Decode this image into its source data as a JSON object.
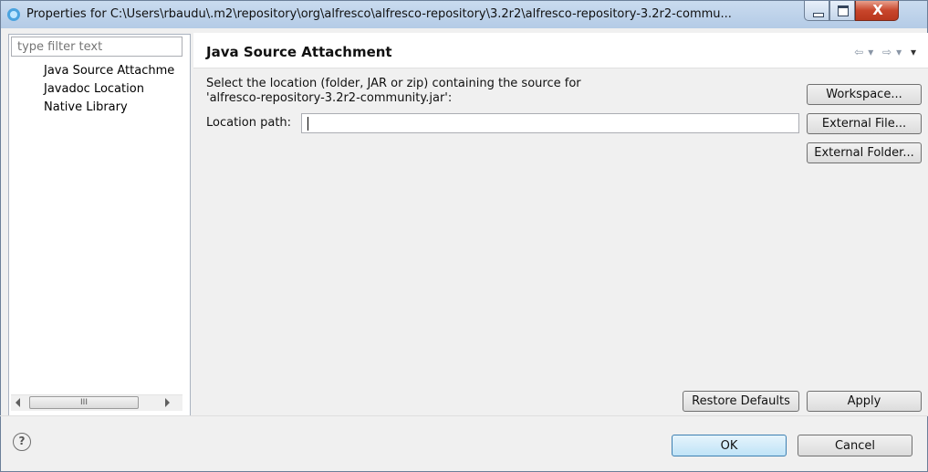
{
  "window": {
    "title": "Properties for C:\\Users\\rbaudu\\.m2\\repository\\org\\alfresco\\alfresco-repository\\3.2r2\\alfresco-repository-3.2r2-commu...",
    "close_glyph": "X"
  },
  "sidebar": {
    "filter_placeholder": "type filter text",
    "items": [
      {
        "label": "Java Source Attachme"
      },
      {
        "label": "Javadoc Location"
      },
      {
        "label": "Native Library"
      }
    ],
    "scroll_thumb_grip": "III"
  },
  "page": {
    "title": "Java Source Attachment",
    "description_line1": "Select the location (folder, JAR or zip) containing the source for",
    "description_line2": "'alfresco-repository-3.2r2-community.jar':",
    "location_label": "Location path:",
    "location_value": ""
  },
  "buttons": {
    "workspace": "Workspace...",
    "external_file": "External File...",
    "external_folder": "External Folder...",
    "restore_defaults": "Restore Defaults",
    "apply": "Apply",
    "ok": "OK",
    "cancel": "Cancel"
  },
  "help": {
    "glyph": "?"
  },
  "colors": {
    "titlebar": "#c9dbef",
    "close_button": "#c8452b",
    "ok_button": "#bfe3f7"
  }
}
